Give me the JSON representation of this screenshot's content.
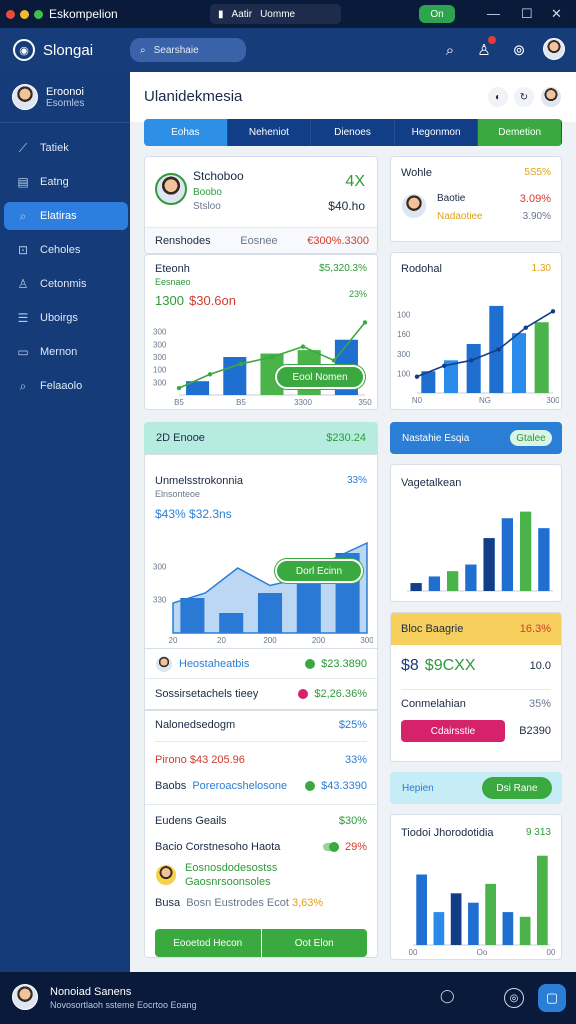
{
  "titlebar": {
    "title": "Eskompelion",
    "center_a": "Aatir",
    "center_b": "Uomme",
    "green_pill": "On",
    "minimize": "—",
    "maximize": "☐",
    "close": "✕"
  },
  "header": {
    "brand": "Slongai",
    "search_placeholder": "Searshaie",
    "icons": [
      "search-icon",
      "bell-icon",
      "settings-icon",
      "avatar"
    ]
  },
  "sidebar": {
    "user": {
      "name": "Eroonoi",
      "sub": "Esomles"
    },
    "items": [
      {
        "label": "Tatiek",
        "icon": "trend-icon"
      },
      {
        "label": "Eatng",
        "icon": "table-icon"
      },
      {
        "label": "Elatiras",
        "icon": "search-icon",
        "active": true
      },
      {
        "label": "Ceholes",
        "icon": "box-icon"
      },
      {
        "label": "Cetonmis",
        "icon": "user-icon"
      },
      {
        "label": "Uboirgs",
        "icon": "list-icon"
      },
      {
        "label": "Mernon",
        "icon": "doc-icon"
      },
      {
        "label": "Felaaolo",
        "icon": "search-icon"
      }
    ]
  },
  "page": {
    "title": "Ulanidekmesia"
  },
  "tabs": [
    {
      "label": "Eohas",
      "color": "#2e8fe6"
    },
    {
      "label": "Neheniot",
      "color": "#123e88"
    },
    {
      "label": "Dienoes",
      "color": "#123e88"
    },
    {
      "label": "Hegonmon",
      "color": "#123e88"
    },
    {
      "label": "Demetion",
      "color": "#3aa940"
    }
  ],
  "profile_card": {
    "name": "Stchoboo",
    "line1": "Boobo",
    "line2": "Stsloo",
    "right_top": "4X",
    "right_val": "$40.ho",
    "row_label": "Renshodes",
    "row_mid": "Eosnee",
    "row_val": "€300%.3300"
  },
  "chart1": {
    "title": "Eteonh",
    "sub": "Eesnaeo",
    "value_left": "1300",
    "value_left2": "$30.6on",
    "top_right": "$5,320.3%",
    "note": "23%",
    "button": "Eool Nomen",
    "y_ticks": [
      "300",
      "100",
      "300",
      "300",
      "300"
    ],
    "x_ticks": [
      "B5",
      "B5",
      "3300",
      "350"
    ],
    "bars": [
      {
        "value": 40,
        "color": "#1f6fd1"
      },
      {
        "value": 110,
        "color": "#1f6fd1"
      },
      {
        "value": 120,
        "color": "#4ab34a"
      },
      {
        "value": 130,
        "color": "#4ab34a"
      },
      {
        "value": 160,
        "color": "#1f6fd1"
      }
    ],
    "line": [
      20,
      60,
      90,
      110,
      140,
      100,
      210
    ]
  },
  "mini_profile": {
    "title": "Wohle",
    "val_top": "5S5%",
    "name": "Baotie",
    "val": "3.09%",
    "sub": "Nadaotiee",
    "sub_val": "3.90%"
  },
  "chart_right": {
    "title": "Rodohal",
    "value": "1.30",
    "y_ticks": [
      "100",
      "300",
      "160",
      "100"
    ],
    "x_ticks": [
      "N0",
      "NG",
      "300"
    ],
    "bars": [
      {
        "value": 40,
        "color": "#1f6fd1"
      },
      {
        "value": 60,
        "color": "#2a8bea"
      },
      {
        "value": 90,
        "color": "#1f6fd1"
      },
      {
        "value": 160,
        "color": "#1f6fd1"
      },
      {
        "value": 110,
        "color": "#2a8bea"
      },
      {
        "value": 130,
        "color": "#4ab34a"
      }
    ],
    "line": [
      30,
      50,
      60,
      80,
      120,
      150
    ]
  },
  "teal_bar": {
    "left": "2D Enooe",
    "right": "$230.24"
  },
  "blue_bar": {
    "left": "Nastahie Esqia",
    "button": "Gtalee"
  },
  "chart2": {
    "title": "Unmelsstrokonnia",
    "sub": "Elnsonteoe",
    "pct": "33%",
    "values": "$43%  $32.3ns",
    "button": "Dorl Ecinn",
    "y_ticks": [
      "330",
      "300"
    ],
    "x_ticks": [
      "20",
      "20",
      "200",
      "200",
      "300"
    ],
    "bars": [
      {
        "value": 70,
        "color": "#1f6fd1"
      },
      {
        "value": 40,
        "color": "#1f6fd1"
      },
      {
        "value": 80,
        "color": "#1f6fd1"
      },
      {
        "value": 130,
        "color": "#1f6fd1"
      },
      {
        "value": 160,
        "color": "#1f6fd1"
      }
    ],
    "area": [
      60,
      80,
      130,
      95,
      110,
      150,
      180
    ]
  },
  "rows_mid": [
    {
      "label": "Heostaheatbis",
      "value": "$23.3890",
      "dot": "#3aa940"
    },
    {
      "label": "Sossirsetachels tieey",
      "value": "$2,26.36%",
      "dot": "#d6226b"
    }
  ],
  "chart_right2": {
    "title": "Vagetalkean",
    "bars": [
      {
        "value": 12,
        "color": "#123e88"
      },
      {
        "value": 22,
        "color": "#1f6fd1"
      },
      {
        "value": 30,
        "color": "#4ab34a"
      },
      {
        "value": 40,
        "color": "#1f6fd1"
      },
      {
        "value": 80,
        "color": "#123e88"
      },
      {
        "value": 110,
        "color": "#1f6fd1"
      },
      {
        "value": 120,
        "color": "#4ab34a"
      },
      {
        "value": 95,
        "color": "#1f6fd1"
      }
    ]
  },
  "orange_card": {
    "title": "Bloc Baagrie",
    "pct": "16.3%",
    "code": "$8",
    "big": "$9CXX",
    "side": "10.0",
    "label": "Conmelahian",
    "label_val": "35%",
    "button": "Cdairsstie",
    "button_val": "B2390"
  },
  "light_bar": {
    "left": "Hepien",
    "button": "Dsi Rane"
  },
  "list_card": {
    "title": "Nalonedsedogm",
    "title_val": "$25%",
    "line1": "Pirono $43 205.96",
    "line1_val": "33%",
    "line2_l": "Baobs",
    "line2_m": "Poreroacshelosone",
    "line2_val": "$43.3390",
    "section": "Eudens Geails",
    "section_val": "$30%",
    "item": "Bacio Corstnesoho Haota",
    "item_val": "29%",
    "green_line": "Eosnosdodesostss",
    "green_line2": "Gaosnrsoonsoles",
    "foot_l": "Busa",
    "foot_m": "Bosn Eustrodes Ecot",
    "foot_val": "3,63%",
    "btn_left": "Eooetod Hecon",
    "btn_right": "Oot Elon"
  },
  "chart_right3": {
    "title": "Tiodoi Jhorodotidia",
    "value": "9 313",
    "x_ticks": [
      "00",
      "Oo",
      "00"
    ],
    "bars": [
      {
        "value": 150,
        "color": "#1f6fd1"
      },
      {
        "value": 70,
        "color": "#2a8bea"
      },
      {
        "value": 110,
        "color": "#123e88"
      },
      {
        "value": 90,
        "color": "#1f6fd1"
      },
      {
        "value": 130,
        "color": "#4ab34a"
      },
      {
        "value": 70,
        "color": "#1f6fd1"
      },
      {
        "value": 60,
        "color": "#4ab34a"
      },
      {
        "value": 190,
        "color": "#4ab34a"
      }
    ]
  },
  "footer": {
    "name": "Nonoiad Sanens",
    "sub": "Novosortlaoh ssteme Eocrtoo Eoang"
  }
}
